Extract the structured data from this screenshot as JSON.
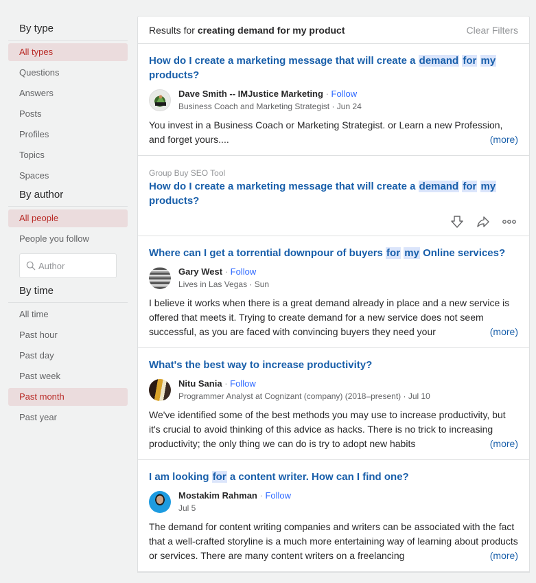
{
  "sidebar": {
    "by_type": {
      "title": "By type",
      "items": [
        {
          "label": "All types",
          "active": true
        },
        {
          "label": "Questions",
          "active": false
        },
        {
          "label": "Answers",
          "active": false
        },
        {
          "label": "Posts",
          "active": false
        },
        {
          "label": "Profiles",
          "active": false
        },
        {
          "label": "Topics",
          "active": false
        },
        {
          "label": "Spaces",
          "active": false
        }
      ]
    },
    "by_author": {
      "title": "By author",
      "items": [
        {
          "label": "All people",
          "active": true
        },
        {
          "label": "People you follow",
          "active": false
        }
      ],
      "author_input": {
        "placeholder": "Author",
        "value": ""
      }
    },
    "by_time": {
      "title": "By time",
      "items": [
        {
          "label": "All time",
          "active": false
        },
        {
          "label": "Past hour",
          "active": false
        },
        {
          "label": "Past day",
          "active": false
        },
        {
          "label": "Past week",
          "active": false
        },
        {
          "label": "Past month",
          "active": true
        },
        {
          "label": "Past year",
          "active": false
        }
      ]
    }
  },
  "header": {
    "prefix": "Results for ",
    "query": "creating demand for my product",
    "clear_label": "Clear Filters"
  },
  "results": [
    {
      "title_parts": [
        "How do I create a marketing message that will create a ",
        "demand",
        " ",
        "for",
        " ",
        "my",
        " products?"
      ],
      "author": "Dave Smith -- IMJustice Marketing",
      "follow": "Follow",
      "credential": "Business Coach and Marketing Strategist · Jun 24",
      "body": "You invest in a Business Coach or Marketing Strategist. or Learn a new Profession, and forget yours....",
      "more": "(more)"
    },
    {
      "pretitle": "Group Buy SEO Tool",
      "title_parts": [
        "How do I create a marketing message that will create a ",
        "demand",
        " ",
        "for",
        " ",
        "my",
        " products?"
      ],
      "actions": [
        "downvote-icon",
        "share-icon",
        "more-options-icon"
      ]
    },
    {
      "title_parts": [
        "Where can I get a torrential downpour of buyers ",
        "for",
        " ",
        "my",
        " Online services?"
      ],
      "author": "Gary West",
      "follow": "Follow",
      "credential": "Lives in Las Vegas · Sun",
      "body": "I believe it works when there is a great demand already in place and a new service is offered that meets it. Trying to create demand for a new service does not seem successful, as you are faced with convincing buyers they need your",
      "more": "(more)"
    },
    {
      "title": "What's the best way to increase productivity?",
      "author": "Nitu Sania",
      "follow": "Follow",
      "credential": "Programmer Analyst at Cognizant (company) (2018–present) · Jul 10",
      "body": "We've identified some of the best methods you may use to increase productivity, but it's crucial to avoid thinking of this advice as hacks. There is no trick to increasing productivity; the only thing we can do is try to adopt new habits",
      "more": "(more)"
    },
    {
      "title_parts": [
        "I am looking ",
        "for",
        " a content writer. How can I find one?"
      ],
      "author": "Mostakim Rahman",
      "follow": "Follow",
      "credential": "Jul 5",
      "body": "The demand for content writing companies and writers can be associated with the fact that a well-crafted storyline is a much more entertaining way of learning about products or services. There are many content writers on a freelancing",
      "more": "(more)"
    }
  ],
  "colors": {
    "accent_red": "#b92b27",
    "active_bg": "#ebdcdd",
    "link_blue": "#195faa",
    "follow_blue": "#2e69ff",
    "highlight": "#dbe5fb"
  }
}
